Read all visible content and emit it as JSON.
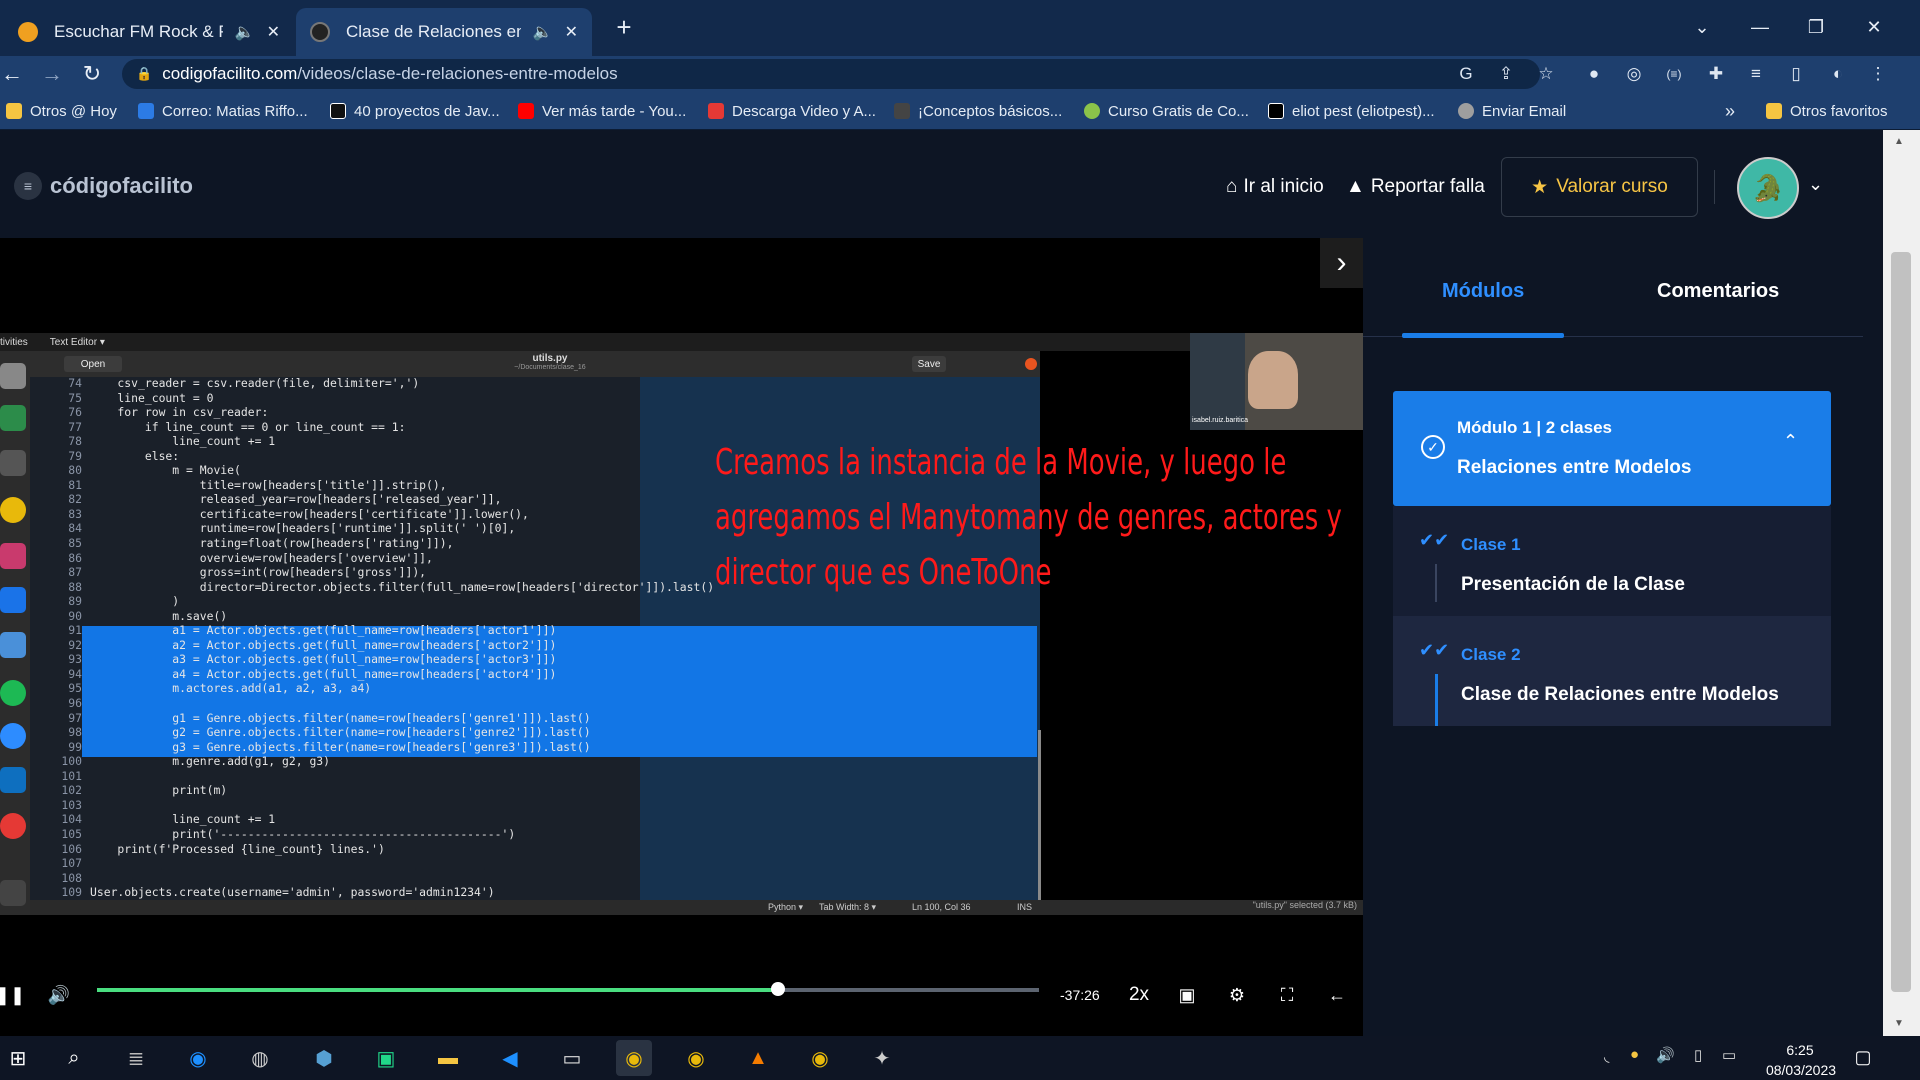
{
  "browser": {
    "tabs": [
      {
        "title": "Escuchar FM Rock & Pop en",
        "audio_icon": "speaker-icon",
        "close": "✕",
        "color": "#f0a020"
      },
      {
        "title": "Clase de Relaciones entre Mo",
        "audio_icon": "speaker-icon",
        "close": "✕",
        "color": "#1a1a1a"
      }
    ],
    "new_tab": "+",
    "url_domain": "codigofacilito.com",
    "url_path": "/videos/clase-de-relaciones-entre-modelos",
    "bookmarks": [
      {
        "label": "Otros @ Hoy",
        "color": "#f5c542"
      },
      {
        "label": "Correo: Matias Riffo...",
        "color": "#2c7be5"
      },
      {
        "label": "40 proyectos de Jav...",
        "color": "#111111"
      },
      {
        "label": "Ver más tarde - You...",
        "color": "#ff0000"
      },
      {
        "label": "Descarga Video y A...",
        "color": "#e53935"
      },
      {
        "label": "¡Conceptos básicos...",
        "color": "#444444"
      },
      {
        "label": "Curso Gratis de Co...",
        "color": "#8bc34a"
      },
      {
        "label": "eliot pest (eliotpest)...",
        "color": "#000000"
      },
      {
        "label": "Enviar Email",
        "color": "#9e9e9e"
      }
    ],
    "bookmarks_more": "»",
    "other_favorites": "Otros favoritos"
  },
  "site": {
    "logo": "códigofacilito",
    "home": "Ir al inicio",
    "report": "Reportar falla",
    "rate": "Valorar curso"
  },
  "video": {
    "overlay_text": "Creamos la instancia de la Movie, y luego le agregamos el Manytomany de genres, actores y director que es OneToOne",
    "time_remaining": "-37:26",
    "speed": "2x",
    "progress": 0.723,
    "editor": {
      "activities": "tivities",
      "app": "Text Editor ▾",
      "open": "Open",
      "save": "Save",
      "filename": "utils.py",
      "filepath": "~/Documents/clase_16",
      "status_lang": "Python ▾",
      "status_tab": "Tab Width: 8 ▾",
      "status_pos": "Ln 100, Col 36",
      "status_ins": "INS",
      "selected_note": "\"utils.py\" selected (3.7 kB)",
      "webcam_name": "isabel.ruiz.baritica"
    },
    "code_lines": [
      {
        "n": "74",
        "t": "    csv_reader = csv.reader(file, delimiter=',')"
      },
      {
        "n": "75",
        "t": "    line_count = 0"
      },
      {
        "n": "76",
        "t": "    for row in csv_reader:"
      },
      {
        "n": "77",
        "t": "        if line_count == 0 or line_count == 1:"
      },
      {
        "n": "78",
        "t": "            line_count += 1"
      },
      {
        "n": "79",
        "t": "        else:"
      },
      {
        "n": "80",
        "t": "            m = Movie("
      },
      {
        "n": "81",
        "t": "                title=row[headers['title']].strip(),"
      },
      {
        "n": "82",
        "t": "                released_year=row[headers['released_year']],"
      },
      {
        "n": "83",
        "t": "                certificate=row[headers['certificate']].lower(),"
      },
      {
        "n": "84",
        "t": "                runtime=row[headers['runtime']].split(' ')[0],"
      },
      {
        "n": "85",
        "t": "                rating=float(row[headers['rating']]),"
      },
      {
        "n": "86",
        "t": "                overview=row[headers['overview']],"
      },
      {
        "n": "87",
        "t": "                gross=int(row[headers['gross']]),"
      },
      {
        "n": "88",
        "t": "                director=Director.objects.filter(full_name=row[headers['director']]).last()"
      },
      {
        "n": "89",
        "t": "            )"
      },
      {
        "n": "90",
        "t": "            m.save()"
      },
      {
        "n": "91",
        "t": "            a1 = Actor.objects.get(full_name=row[headers['actor1']])"
      },
      {
        "n": "92",
        "t": "            a2 = Actor.objects.get(full_name=row[headers['actor2']])"
      },
      {
        "n": "93",
        "t": "            a3 = Actor.objects.get(full_name=row[headers['actor3']])"
      },
      {
        "n": "94",
        "t": "            a4 = Actor.objects.get(full_name=row[headers['actor4']])"
      },
      {
        "n": "95",
        "t": "            m.actores.add(a1, a2, a3, a4)"
      },
      {
        "n": "96",
        "t": ""
      },
      {
        "n": "97",
        "t": "            g1 = Genre.objects.filter(name=row[headers['genre1']]).last()"
      },
      {
        "n": "98",
        "t": "            g2 = Genre.objects.filter(name=row[headers['genre2']]).last()"
      },
      {
        "n": "99",
        "t": "            g3 = Genre.objects.filter(name=row[headers['genre3']]).last()"
      },
      {
        "n": "100",
        "t": "            m.genre.add(g1, g2, g3)"
      },
      {
        "n": "101",
        "t": ""
      },
      {
        "n": "102",
        "t": "            print(m)"
      },
      {
        "n": "103",
        "t": ""
      },
      {
        "n": "104",
        "t": "            line_count += 1"
      },
      {
        "n": "105",
        "t": "            print('-----------------------------------------')"
      },
      {
        "n": "106",
        "t": "    print(f'Processed {line_count} lines.')"
      },
      {
        "n": "107",
        "t": ""
      },
      {
        "n": "108",
        "t": ""
      },
      {
        "n": "109",
        "t": "User.objects.create(username='admin', password='admin1234')"
      }
    ]
  },
  "sidebar": {
    "tabs": [
      "Módulos",
      "Comentarios"
    ],
    "module": {
      "header": "Módulo 1  |  2 clases",
      "title": "Relaciones entre Modelos"
    },
    "lessons": [
      {
        "label": "Clase 1",
        "title": "Presentación de la Clase"
      },
      {
        "label": "Clase 2",
        "title": "Clase de Relaciones entre Modelos"
      }
    ]
  },
  "taskbar": {
    "time": "6:25",
    "date": "08/03/2023"
  },
  "colors": {
    "accent": "#1a7de8",
    "progress": "#4ade80",
    "overlay": "#ff1a1a",
    "rate": "#f7c545"
  }
}
